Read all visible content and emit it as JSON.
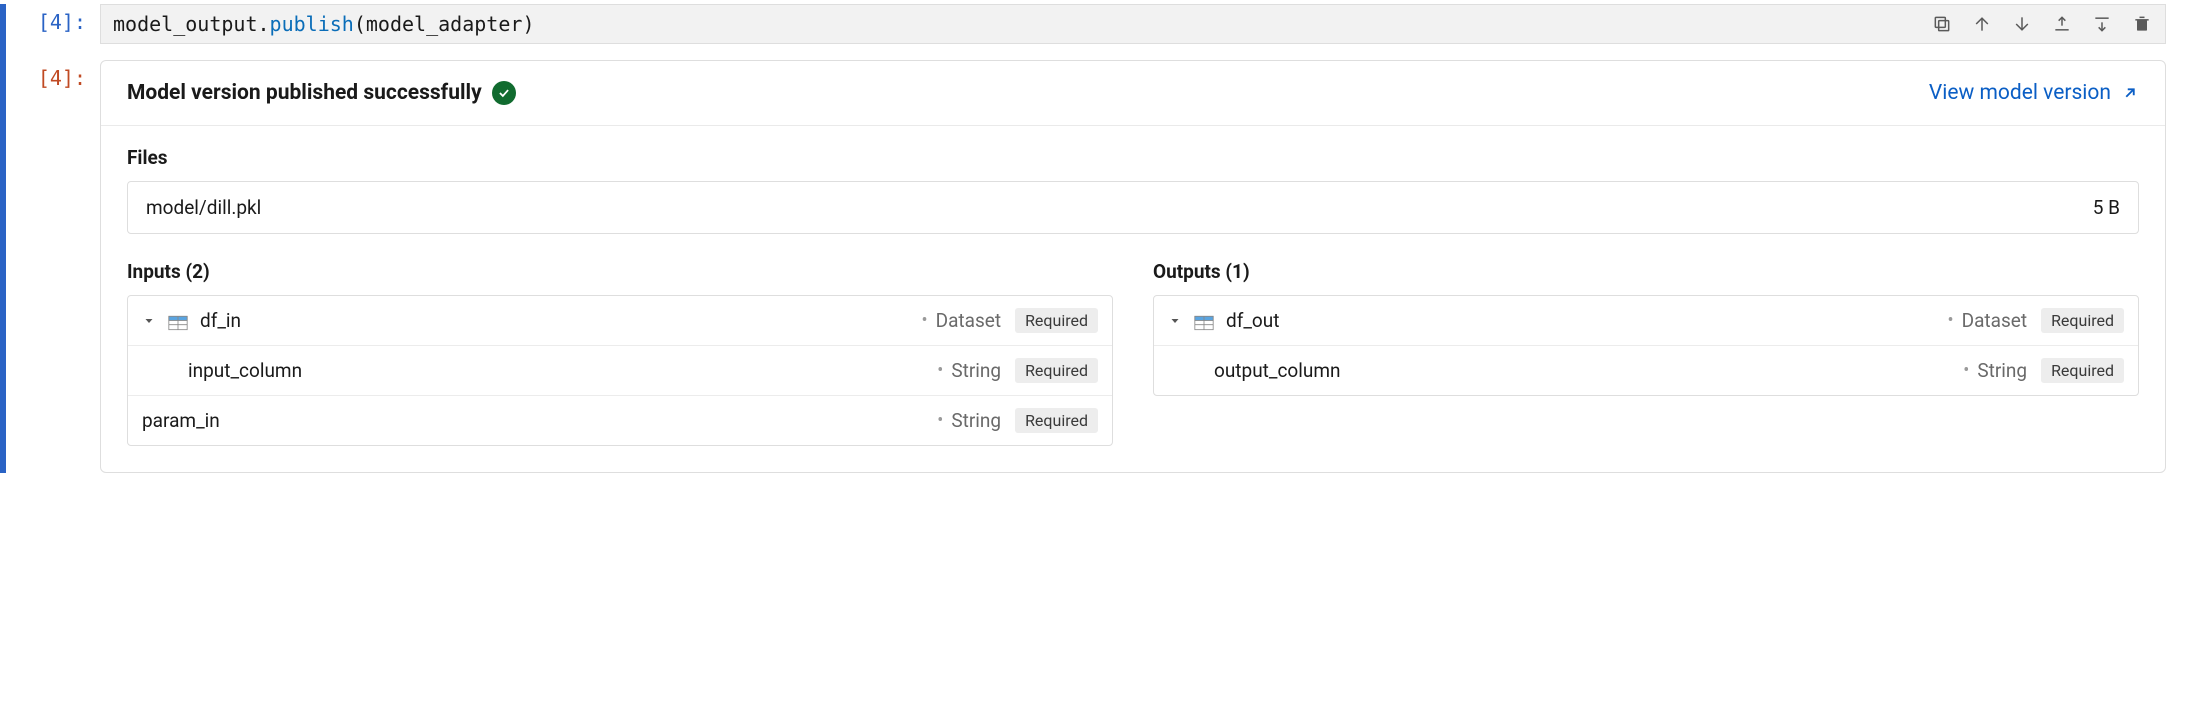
{
  "input_prompt": "[4]:",
  "output_prompt": "[4]:",
  "code": {
    "obj": "model_output",
    "dot": ".",
    "method": "publish",
    "open": "(",
    "arg": "model_adapter",
    "close": ")"
  },
  "panel": {
    "title": "Model version published successfully",
    "view_link": "View model version"
  },
  "files": {
    "label": "Files",
    "items": [
      {
        "name": "model/dill.pkl",
        "size": "5 B"
      }
    ]
  },
  "inputs": {
    "label": "Inputs (2)",
    "rows": [
      {
        "name": "df_in",
        "type": "Dataset",
        "required": "Required",
        "dataset": true,
        "children": [
          {
            "name": "input_column",
            "type": "String",
            "required": "Required"
          }
        ]
      },
      {
        "name": "param_in",
        "type": "String",
        "required": "Required",
        "dataset": false
      }
    ]
  },
  "outputs": {
    "label": "Outputs (1)",
    "rows": [
      {
        "name": "df_out",
        "type": "Dataset",
        "required": "Required",
        "dataset": true,
        "children": [
          {
            "name": "output_column",
            "type": "String",
            "required": "Required"
          }
        ]
      }
    ]
  }
}
